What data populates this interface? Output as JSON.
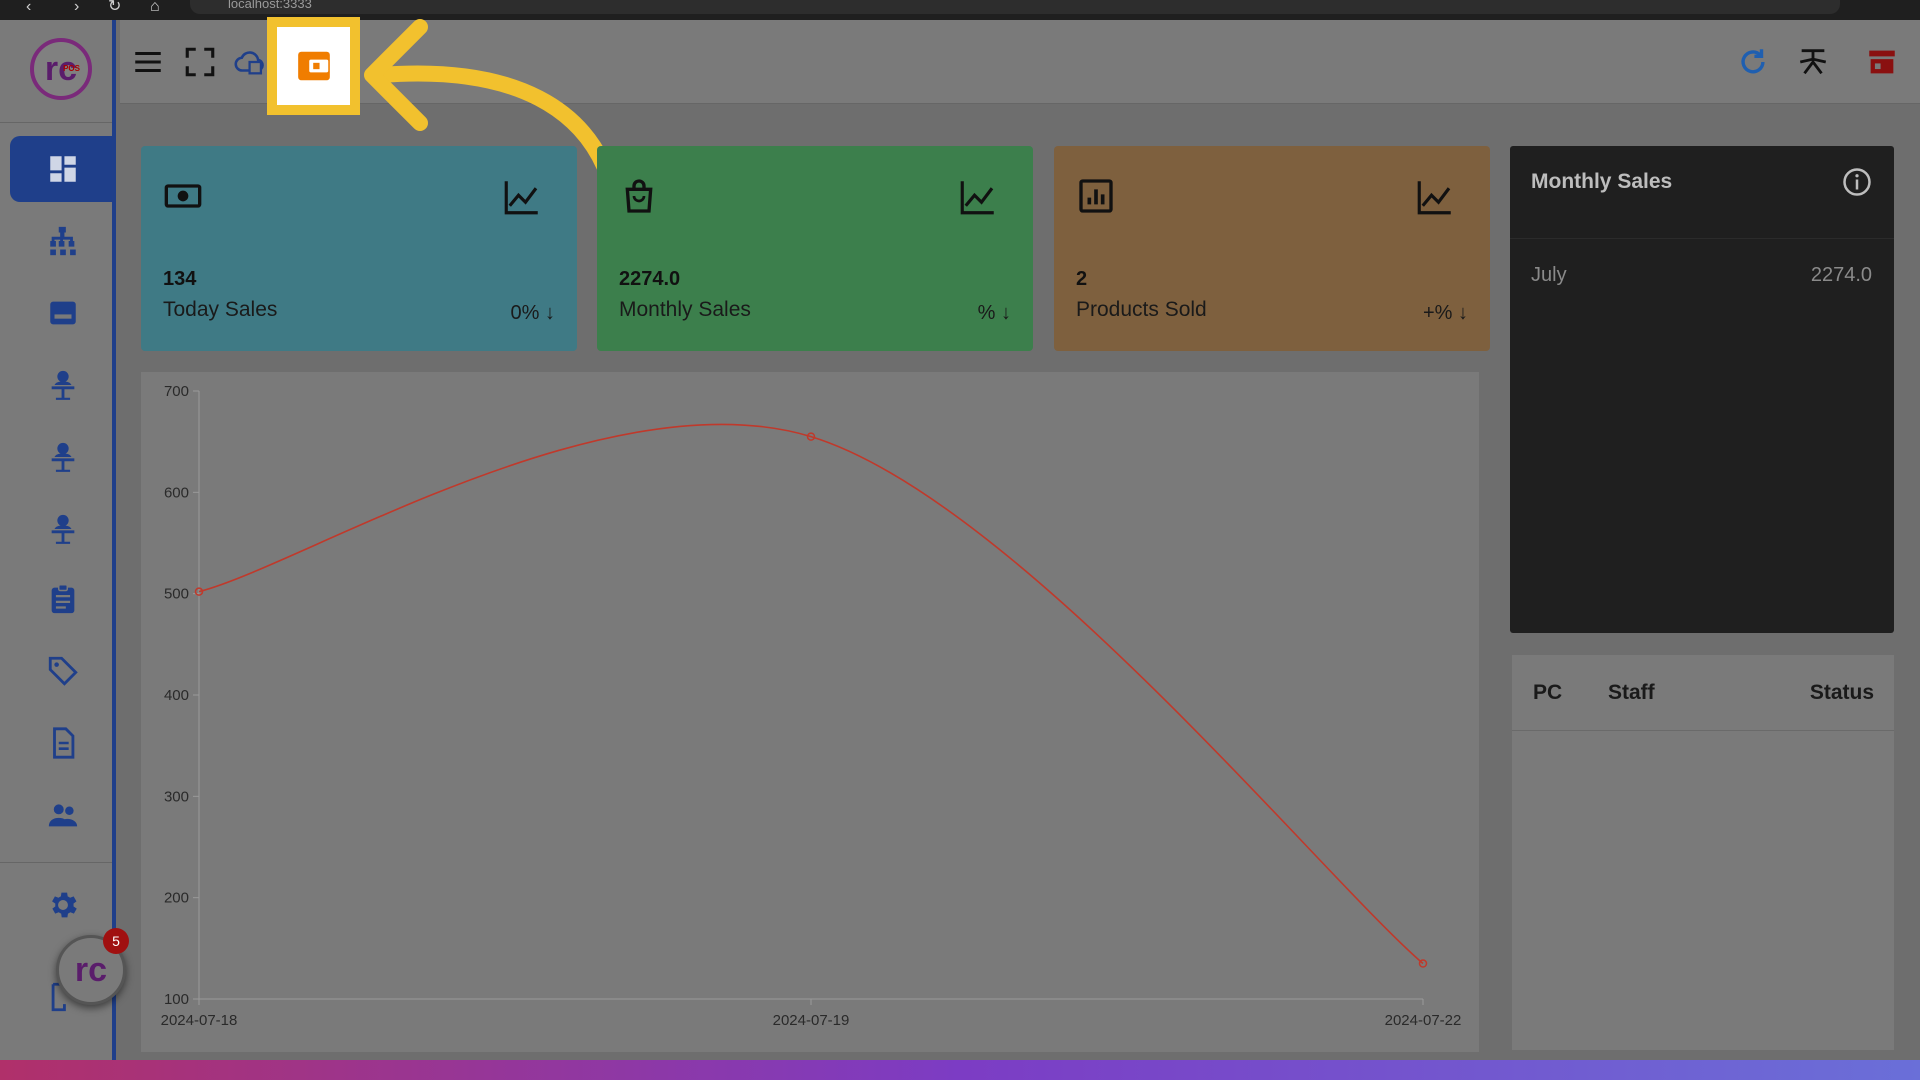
{
  "browser": {
    "url": "localhost:3333"
  },
  "brand": {
    "logo_text": "rc",
    "logo_sub": "POS"
  },
  "fab": {
    "badge": "5",
    "logo_text": "rc"
  },
  "cards": [
    {
      "value": "134",
      "label": "Today Sales",
      "change": "0% ↓",
      "icon": "money-icon"
    },
    {
      "value": "2274.0",
      "label": "Monthly Sales",
      "change": "% ↓",
      "icon": "shopping-bag-icon"
    },
    {
      "value": "2",
      "label": "Products Sold",
      "change": "+% ↓",
      "icon": "bar-chart-icon"
    }
  ],
  "monthly_sales": {
    "title": "Monthly Sales",
    "rows": [
      {
        "month": "July",
        "value": "2274.0"
      }
    ]
  },
  "staff_table": {
    "headers": [
      "PC",
      "Staff",
      "Status"
    ]
  },
  "colors": {
    "accent": "#1f3f8a",
    "highlight": "#f2c12e",
    "line": "#c0392b",
    "card1": "#3f7a85",
    "card2": "#3c7f4c",
    "card3": "#7e603e"
  },
  "chart_data": {
    "type": "line",
    "x": [
      "2024-07-18",
      "2024-07-19",
      "2024-07-22"
    ],
    "series": [
      {
        "values": [
          502,
          655,
          135
        ]
      }
    ],
    "ylim": [
      100,
      700
    ],
    "yticks": [
      100,
      200,
      300,
      400,
      500,
      600,
      700
    ],
    "grid": false,
    "title": "",
    "xlabel": "",
    "ylabel": ""
  }
}
